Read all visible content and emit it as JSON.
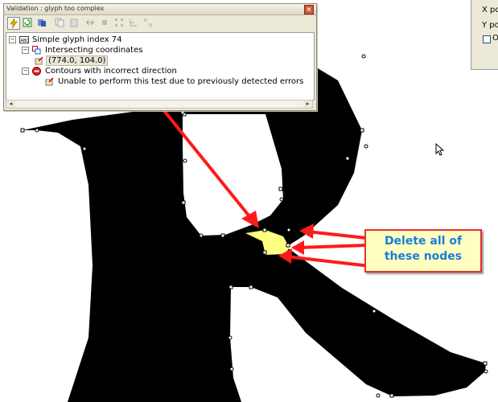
{
  "validation_window": {
    "title": "Validation : glyph too complex",
    "close_glyph": "×",
    "tree": {
      "root": {
        "label": "Simple glyph index 74",
        "icon": "glyph-abc-icon"
      },
      "issues": [
        {
          "label": "Intersecting coordinates",
          "icon": "intersect-icon",
          "children": [
            {
              "label": "(774.0, 104.0)",
              "icon": "node-pin-icon"
            }
          ]
        },
        {
          "label": "Contours with incorrect direction",
          "icon": "error-stop-icon",
          "children": [
            {
              "label": "Unable to perform this test due to previously detected errors",
              "icon": "node-pin-icon"
            }
          ]
        }
      ]
    }
  },
  "callout": {
    "line1": "Delete all of",
    "line2": "these nodes"
  },
  "coord_panel": {
    "x_label": "X po",
    "y_label": "Y po",
    "check_label": "O"
  },
  "colors": {
    "glyph": "#000000",
    "highlight": "#ffff80",
    "arrow": "#ff0000",
    "callout_text": "#1b7cdc",
    "callout_border": "#e43030"
  }
}
